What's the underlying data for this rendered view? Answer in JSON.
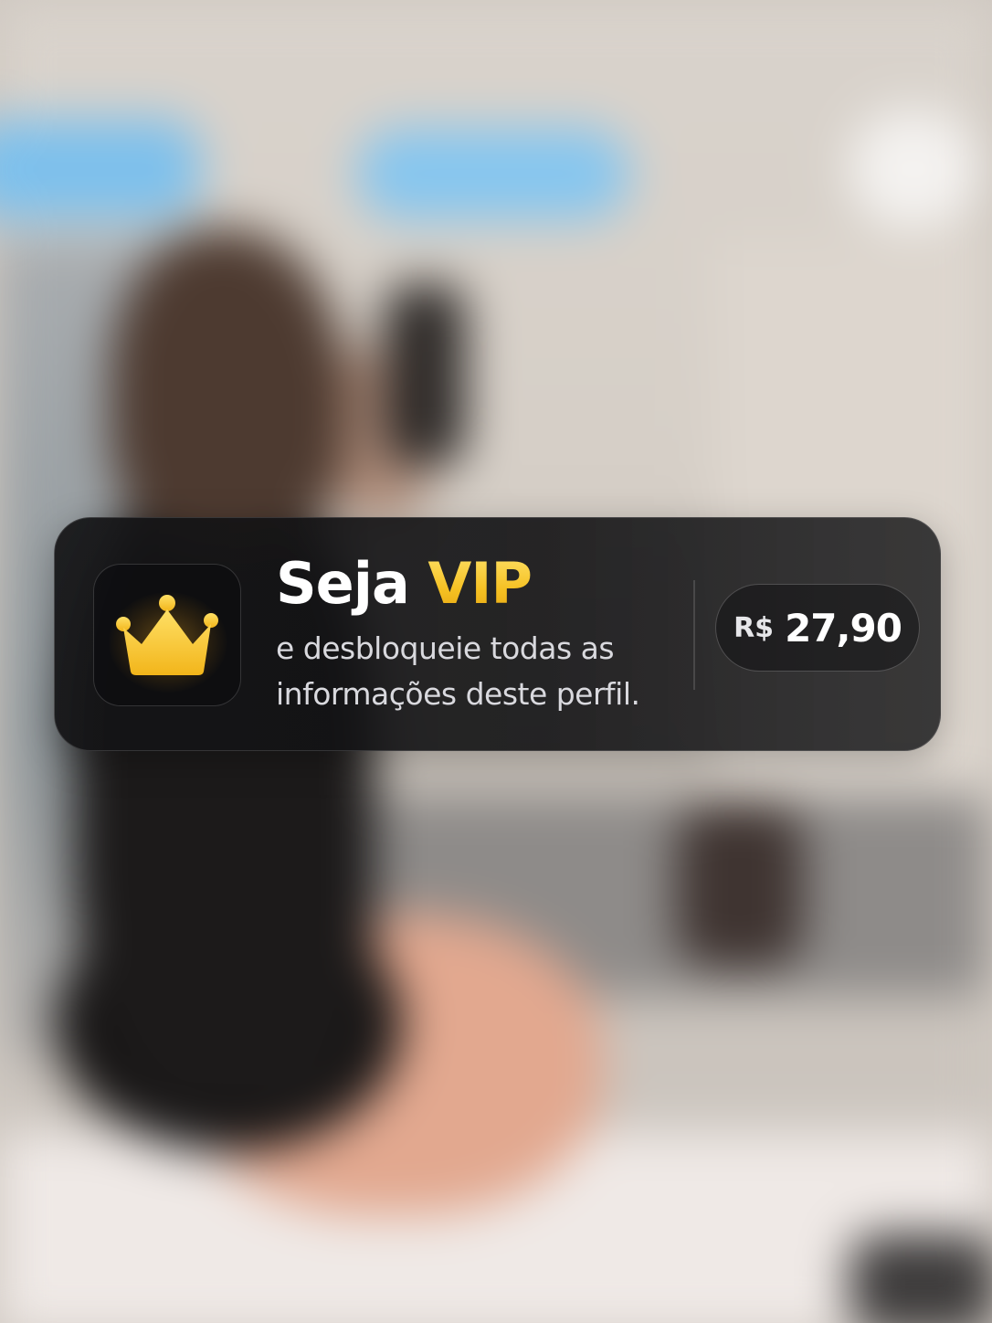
{
  "banner": {
    "title_prefix": "Seja",
    "title_highlight": "VIP",
    "subtitle": "e desbloqueie todas as informações deste perfil.",
    "price": {
      "currency": "R$",
      "amount": "27,90"
    },
    "icon": "crown-icon"
  },
  "colors": {
    "accent_gold": "#f5c022",
    "card_background": "#141416",
    "text_primary": "#ffffff",
    "text_secondary": "#d9d9de"
  }
}
